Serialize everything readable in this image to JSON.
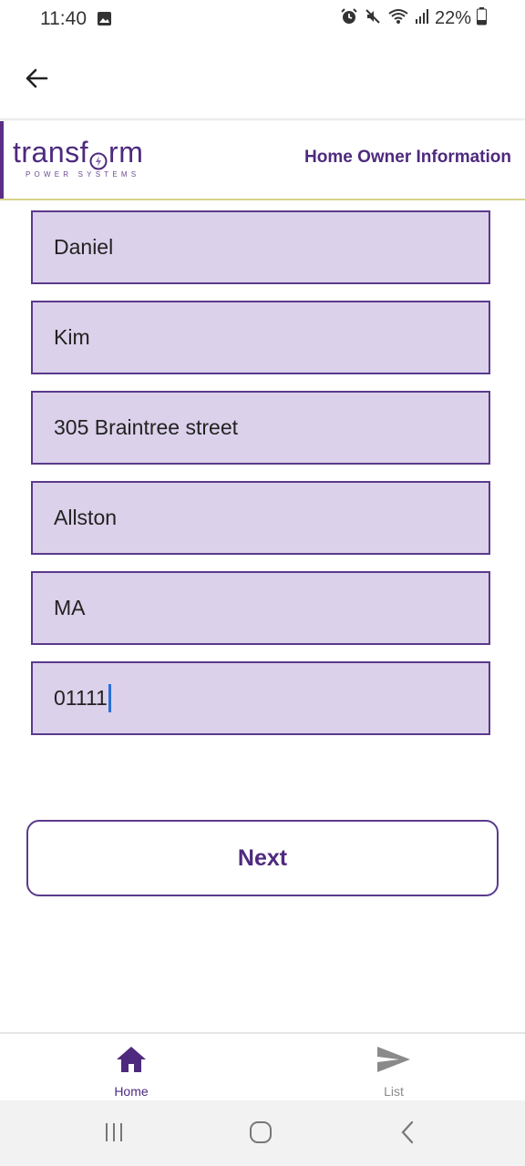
{
  "status_bar": {
    "time": "11:40",
    "battery_text": "22%",
    "icons": [
      "image-icon",
      "alarm-icon",
      "mute-icon",
      "wifi-icon",
      "signal-icon",
      "battery-icon"
    ]
  },
  "app_bar": {
    "back_icon": "arrow-left-icon"
  },
  "header": {
    "logo_word_left": "transf",
    "logo_word_right": "rm",
    "logo_subtitle": "POWER SYSTEMS",
    "title": "Home Owner Information"
  },
  "form": {
    "fields": [
      {
        "value": "Daniel"
      },
      {
        "value": "Kim"
      },
      {
        "value": "305 Braintree street"
      },
      {
        "value": "Allston"
      },
      {
        "value": "MA"
      },
      {
        "value": "01111"
      }
    ],
    "next_label": "Next"
  },
  "bottom_nav": {
    "items": [
      {
        "label": "Home",
        "icon": "home-icon",
        "active": true
      },
      {
        "label": "List",
        "icon": "send-icon",
        "active": false
      }
    ]
  },
  "system_nav": {
    "icons": [
      "recents-icon",
      "home-circle-icon",
      "back-chevron-icon"
    ]
  },
  "colors": {
    "brand": "#4e2a7e",
    "field_fill": "#dbd1ea",
    "field_border": "#5a3a8c",
    "accent_line": "#d8d38a",
    "caret": "#2a6fd6"
  }
}
